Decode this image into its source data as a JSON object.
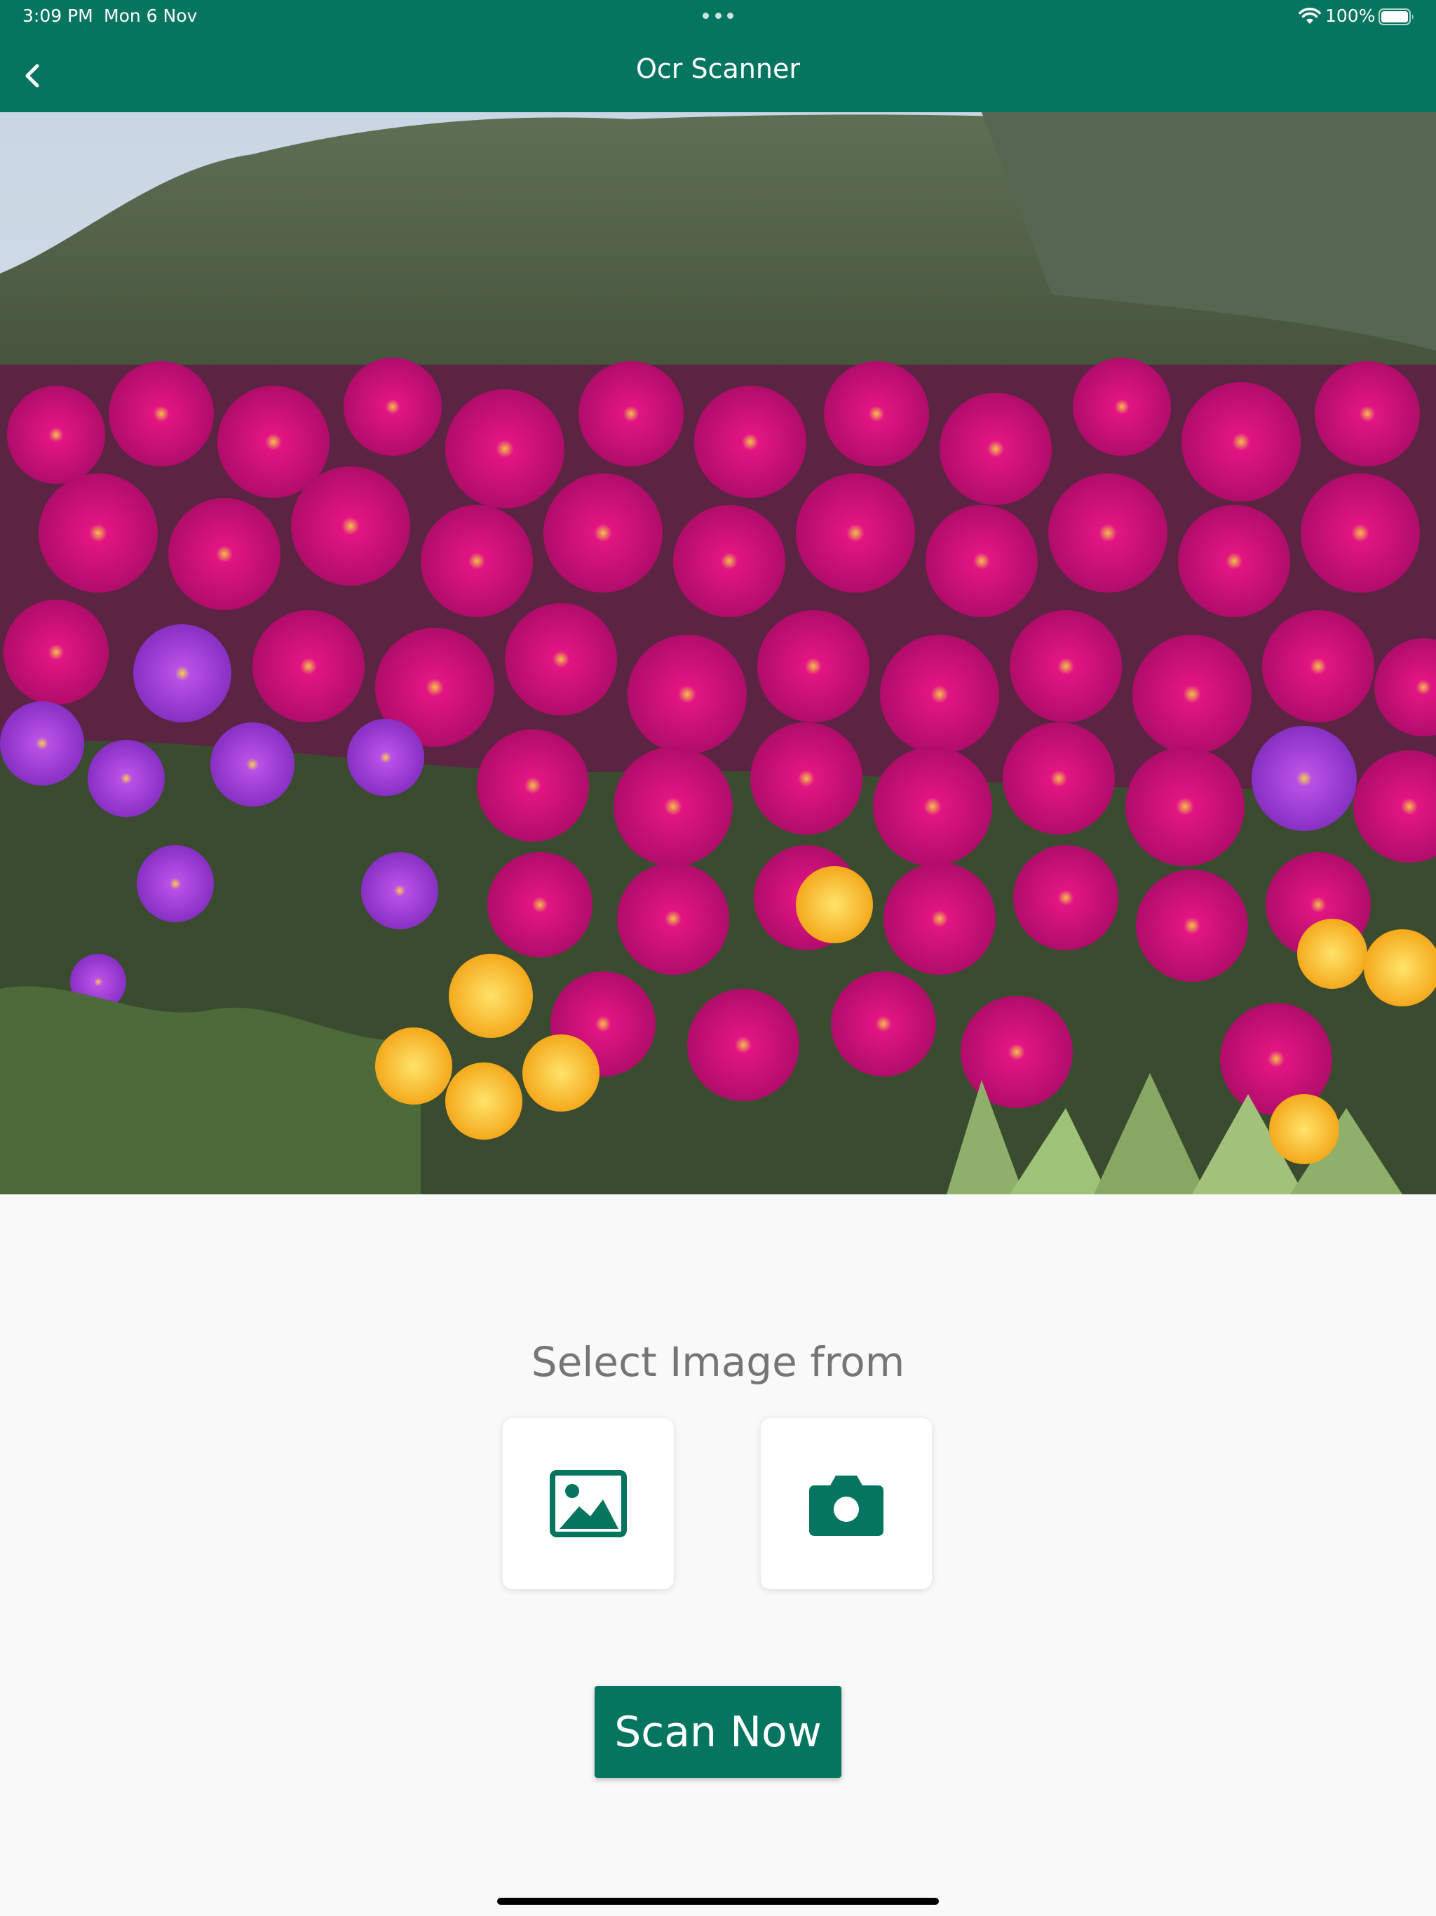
{
  "status_bar": {
    "time": "3:09 PM",
    "date": "Mon 6 Nov",
    "battery": "100%"
  },
  "header": {
    "title": "Ocr Scanner",
    "back_icon": "chevron-left-icon"
  },
  "preview_image": {
    "subject": "flower-field-photo"
  },
  "source_picker": {
    "label": "Select Image from",
    "options": [
      {
        "id": "gallery",
        "icon": "image-icon"
      },
      {
        "id": "camera",
        "icon": "camera-icon"
      }
    ]
  },
  "actions": {
    "scan_label": "Scan Now"
  },
  "colors": {
    "primary": "#067560",
    "background": "#f9f9f9",
    "card": "#ffffff",
    "label_gray": "#757575"
  }
}
